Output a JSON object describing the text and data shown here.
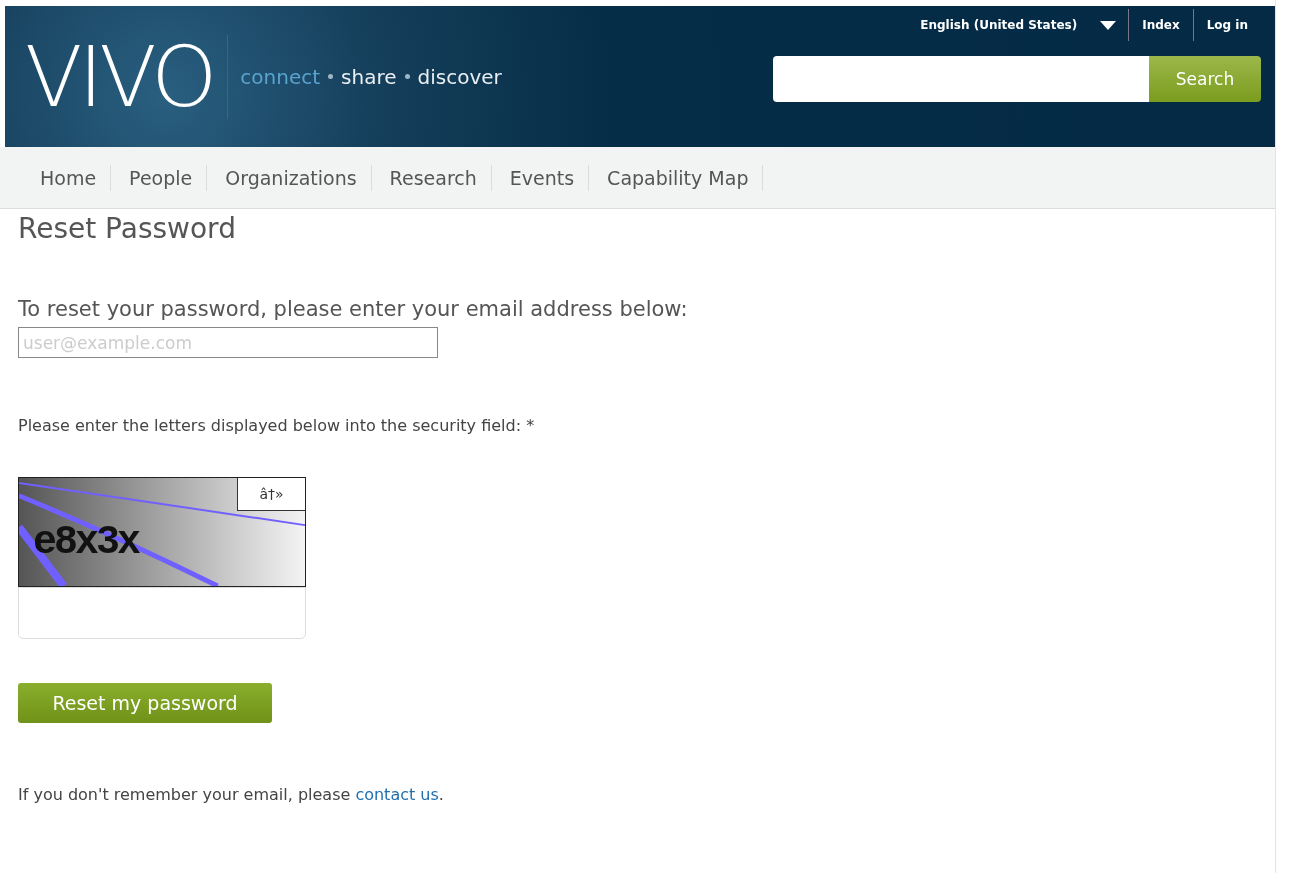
{
  "header": {
    "logo": "VIVO",
    "tagline": [
      {
        "text": "connect",
        "kind": "accent"
      },
      {
        "text": "share",
        "kind": "plain"
      },
      {
        "text": "discover",
        "kind": "plain"
      }
    ],
    "language": "English (United States)",
    "links": [
      "Index",
      "Log in"
    ],
    "search_button": "Search"
  },
  "nav": [
    "Home",
    "People",
    "Organizations",
    "Research",
    "Events",
    "Capability Map"
  ],
  "page": {
    "title": "Reset Password",
    "intro": "To reset your password, please enter your email address below:",
    "email_placeholder": "user@example.com",
    "captcha_prompt": "Please enter the letters displayed below into the security field: *",
    "captcha_text": "e8x3x",
    "captcha_refresh": "â†»",
    "submit": "Reset my password",
    "footer_text": "If you don't remember your email, please ",
    "footer_link": "contact us",
    "footer_end": "."
  }
}
